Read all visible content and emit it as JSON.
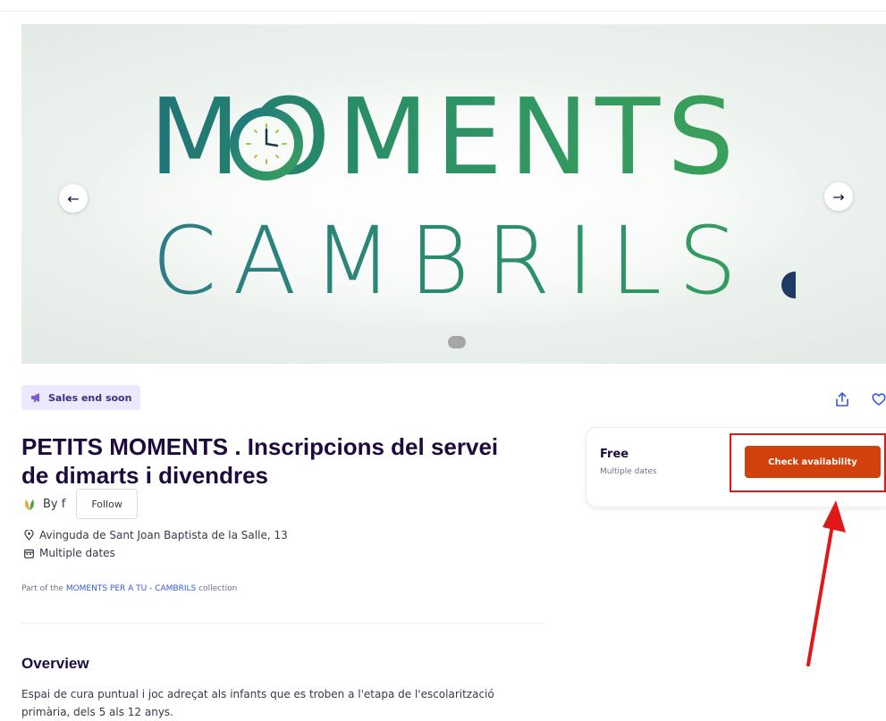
{
  "hero": {
    "line1": "MOMENTS",
    "line2": "CAMBRILS",
    "prev_icon": "arrow-left-icon",
    "next_icon": "arrow-right-icon"
  },
  "badge": {
    "label": "Sales end soon",
    "icon": "megaphone-icon",
    "color": "#ebe8ff"
  },
  "actions": {
    "share_icon": "share-icon",
    "like_icon": "heart-icon"
  },
  "event": {
    "title": "PETITS MOMENTS . Inscripcions del servei de dimarts i divendres",
    "organizer_by": "By f",
    "follow_label": "Follow",
    "location": "Avinguda de Sant Joan Baptista de la Salle, 13",
    "dates": "Multiple dates",
    "collection_prefix": "Part of the",
    "collection_link": "MOMENTS PER A TU - CAMBRILS",
    "collection_suffix": "collection"
  },
  "overview": {
    "heading": "Overview",
    "text": "Espai de cura puntual i joc adreçat als infants que es troben a l'etapa de l'escolarització primària, dels 5 als 12 anys."
  },
  "ticket": {
    "price": "Free",
    "dates": "Multiple dates",
    "cta_label": "Check availability",
    "cta_color": "#d1410c"
  },
  "annotation": {
    "box_color": "#e01818",
    "arrow_color": "#e01818"
  }
}
